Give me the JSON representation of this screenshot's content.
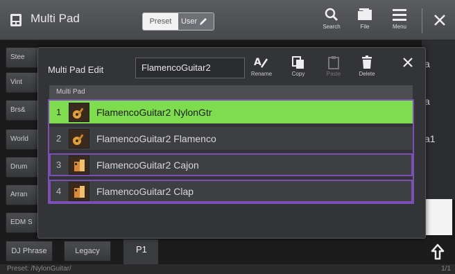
{
  "header": {
    "title": "Multi Pad",
    "preset_label": "Preset",
    "user_label": "User",
    "search_label": "Search",
    "file_label": "File",
    "menu_label": "Menu"
  },
  "background": {
    "left_tabs": [
      "Stee",
      "Vint",
      "Brs&",
      "World",
      "Drum",
      "Arran",
      "EDM S"
    ],
    "right_texts": [
      "a",
      "a",
      "a1"
    ],
    "bottom_buttons": [
      "DJ Phrase",
      "Legacy"
    ],
    "page_tab": "P1",
    "status_text": "Preset: /NylonGuitar/",
    "status_right": "1/1"
  },
  "dialog": {
    "title": "Multi Pad Edit",
    "name_value": "FlamencoGuitar2",
    "rename_label": "Rename",
    "copy_label": "Copy",
    "paste_label": "Paste",
    "delete_label": "Delete",
    "list_header": "Multi Pad",
    "rows": [
      {
        "num": "1",
        "name": "FlamencoGuitar2 NylonGtr",
        "icon": "guitar-icon"
      },
      {
        "num": "2",
        "name": "FlamencoGuitar2 Flamenco",
        "icon": "guitar-icon"
      },
      {
        "num": "3",
        "name": "FlamencoGuitar2 Cajon",
        "icon": "percussion-icon"
      },
      {
        "num": "4",
        "name": "FlamencoGuitar2 Clap",
        "icon": "percussion-icon"
      }
    ]
  },
  "colors": {
    "selected_row": "#7fdc4e",
    "outline": "#7b4fb6",
    "header_bg": "#505256"
  }
}
